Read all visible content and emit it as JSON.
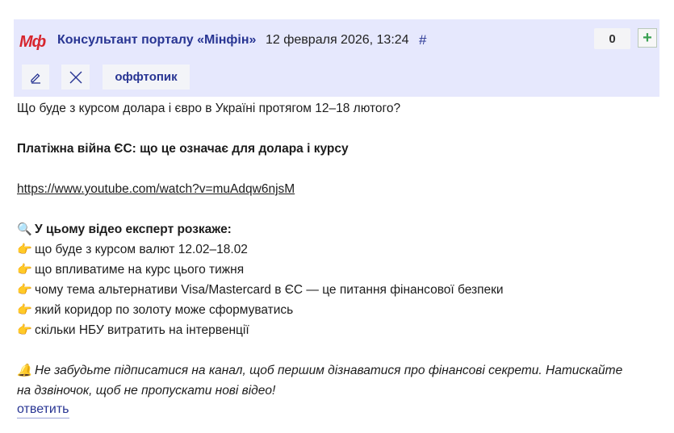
{
  "post": {
    "logo_text": "Мф",
    "author": "Консультант порталу «Мінфін»",
    "date": "12 февраля 2026, 13:24",
    "anchor": "#",
    "score": "0",
    "plus": "+",
    "offtopic_label": "оффтопик",
    "icons": {
      "edit": "pencil-icon",
      "close": "close-icon",
      "search": "magnifier-emoji",
      "pointer": "pointing-hand-emoji",
      "bell": "bell-emoji"
    }
  },
  "body": {
    "line1": "Що буде з курсом долара і євро в Україні протягом 12–18 лютого?",
    "line2": "Платіжна війна ЄС: що це означає для долара і курсу",
    "link": "https://www.youtube.com/watch?v=muAdqw6njsM",
    "list_heading": "У цьому відео експерт розкаже:",
    "items": [
      "що буде з курсом валют 12.02–18.02",
      "що впливатиме на курс цього тижня",
      "чому тема альтернативи Visa/Mastercard в ЄС — це питання фінансової безпеки",
      "який коридор по золоту може сформуватись",
      "скільки НБУ витратить на інтервенції"
    ],
    "footer_line1": "Не забудьте підписатися на канал, щоб першим дізнаватися про фінансові секрети. Натискайте",
    "footer_line2": "на дзвіночок, щоб не пропускати нові відео!"
  },
  "actions": {
    "reply": "ответить"
  }
}
